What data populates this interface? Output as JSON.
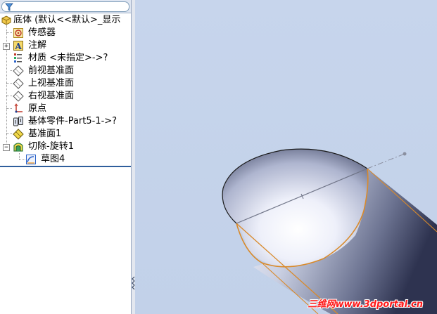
{
  "feature_tree": {
    "root_label": "底体 (默认<<默认>_显示",
    "items": [
      {
        "label": "传感器",
        "icon": "sensor-icon"
      },
      {
        "label": "注解",
        "icon": "annotation-icon"
      },
      {
        "label": "材质 <未指定>->?",
        "icon": "material-icon"
      },
      {
        "label": "前视基准面",
        "icon": "plane-icon"
      },
      {
        "label": "上视基准面",
        "icon": "plane-icon"
      },
      {
        "label": "右视基准面",
        "icon": "plane-icon"
      },
      {
        "label": "原点",
        "icon": "origin-icon"
      },
      {
        "label": "基体零件-Part5-1->?",
        "icon": "base-part-icon"
      },
      {
        "label": "基准面1",
        "icon": "plane1-icon"
      },
      {
        "label": "切除-旋转1",
        "icon": "cut-revolve-icon"
      },
      {
        "label": "草图4",
        "icon": "sketch-icon"
      }
    ]
  },
  "watermark": "三维网www.3dportal.cn",
  "colors": {
    "viewport_bg": "#c4d3ea",
    "selection_edge": "#d98a2b",
    "separator": "#2f5e9c"
  }
}
